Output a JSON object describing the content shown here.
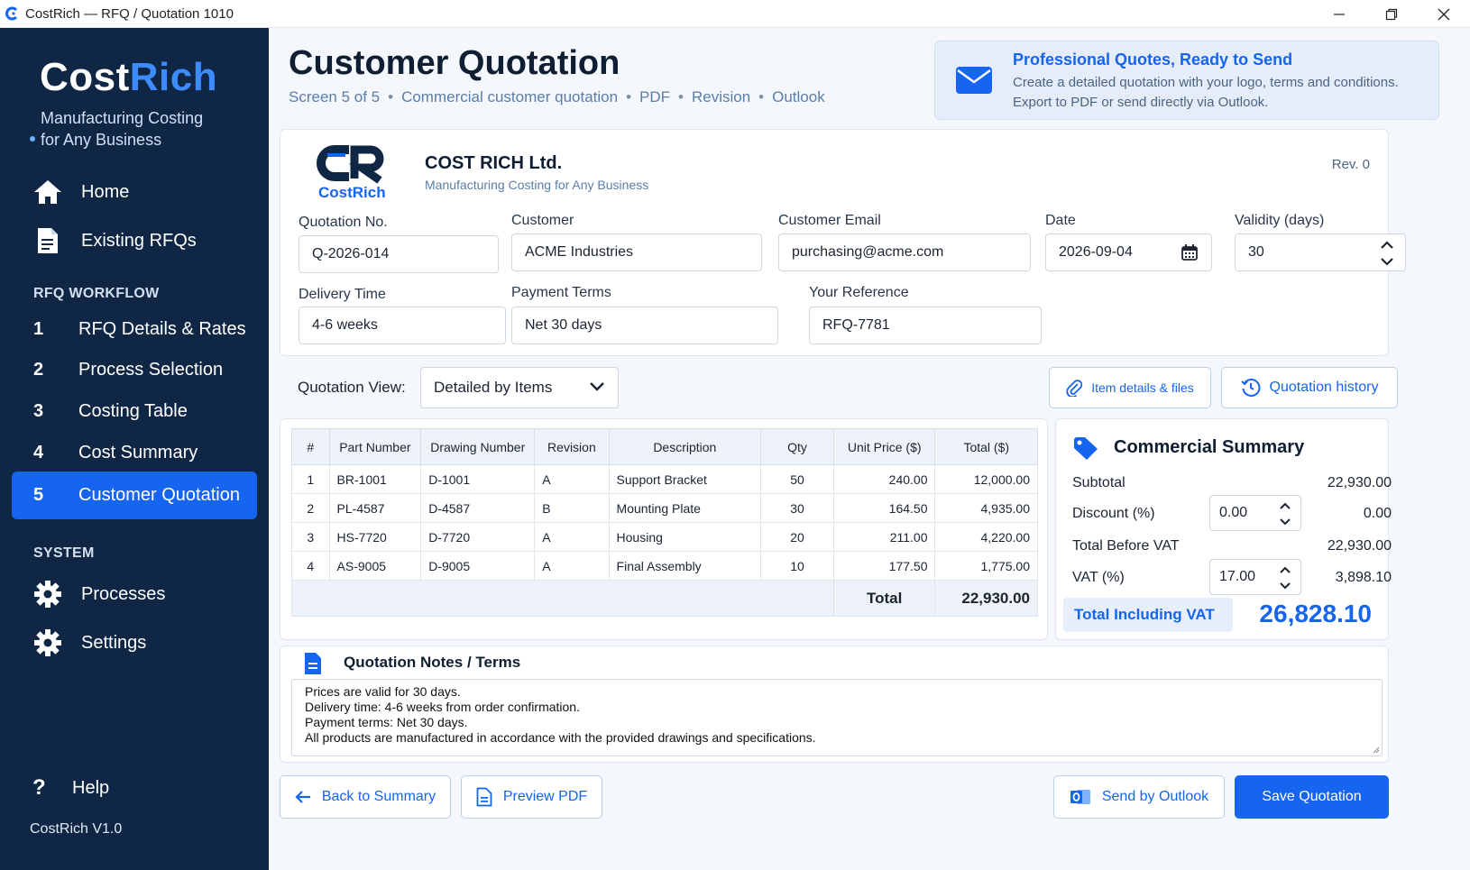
{
  "window": {
    "title": "CostRich — RFQ / Quotation 1010"
  },
  "sidebar": {
    "logo_a": "Cost",
    "logo_b": "Rich",
    "tagline_1": "Manufacturing Costing",
    "tagline_2": "for Any Business",
    "nav": [
      {
        "label": "Home",
        "icon": "home-icon"
      },
      {
        "label": "Existing RFQs",
        "icon": "document-icon"
      }
    ],
    "workflow_header": "RFQ WORKFLOW",
    "workflow": [
      {
        "num": "1",
        "label": "RFQ Details & Rates"
      },
      {
        "num": "2",
        "label": "Process Selection"
      },
      {
        "num": "3",
        "label": "Costing Table"
      },
      {
        "num": "4",
        "label": "Cost Summary"
      },
      {
        "num": "5",
        "label": "Customer Quotation"
      }
    ],
    "system_header": "SYSTEM",
    "system": [
      {
        "label": "Processes",
        "icon": "gear-icon"
      },
      {
        "label": "Settings",
        "icon": "gear-icon"
      }
    ],
    "help": "Help",
    "version": "CostRich  V1.0"
  },
  "header": {
    "title": "Customer Quotation",
    "crumbs": [
      "Screen 5 of 5",
      "Commercial customer quotation",
      "PDF",
      "Revision",
      "Outlook"
    ]
  },
  "promo": {
    "title": "Professional Quotes, Ready to Send",
    "line1": "Create a detailed quotation with your logo, terms and conditions.",
    "line2": "Export to PDF or send directly via Outlook."
  },
  "company": {
    "logo_text": "CostRich",
    "name": "COST RICH Ltd.",
    "subtitle": "Manufacturing Costing for Any Business",
    "revision": "Rev. 0"
  },
  "form": {
    "quotation_no_label": "Quotation No.",
    "quotation_no": "Q-2026-014",
    "customer_label": "Customer",
    "customer": "ACME Industries",
    "email_label": "Customer Email",
    "email": "purchasing@acme.com",
    "date_label": "Date",
    "date": "2026-09-04",
    "validity_label": "Validity (days)",
    "validity": "30",
    "delivery_label": "Delivery Time",
    "delivery": "4-6 weeks",
    "payment_label": "Payment Terms",
    "payment": "Net 30 days",
    "reference_label": "Your Reference",
    "reference": "RFQ-7781"
  },
  "view": {
    "label": "Quotation View:",
    "selected": "Detailed by Items",
    "item_details_btn": "Item details & files",
    "history_btn": "Quotation history"
  },
  "table": {
    "headers": [
      "#",
      "Part Number",
      "Drawing Number",
      "Revision",
      "Description",
      "Qty",
      "Unit Price ($)",
      "Total ($)"
    ],
    "rows": [
      [
        "1",
        "BR-1001",
        "D-1001",
        "A",
        "Support Bracket",
        "50",
        "240.00",
        "12,000.00"
      ],
      [
        "2",
        "PL-4587",
        "D-4587",
        "B",
        "Mounting Plate",
        "30",
        "164.50",
        "4,935.00"
      ],
      [
        "3",
        "HS-7720",
        "D-7720",
        "A",
        "Housing",
        "20",
        "211.00",
        "4,220.00"
      ],
      [
        "4",
        "AS-9005",
        "D-9005",
        "A",
        "Final Assembly",
        "10",
        "177.50",
        "1,775.00"
      ]
    ],
    "total_label": "Total",
    "total_value": "22,930.00"
  },
  "summary": {
    "title": "Commercial Summary",
    "subtotal_label": "Subtotal",
    "subtotal": "22,930.00",
    "discount_label": "Discount (%)",
    "discount_input": "0.00",
    "discount": "0.00",
    "before_vat_label": "Total Before VAT",
    "before_vat": "22,930.00",
    "vat_label": "VAT (%)",
    "vat_input": "17.00",
    "vat": "3,898.10",
    "grand_label": "Total Including VAT",
    "grand": "26,828.10"
  },
  "notes": {
    "title": "Quotation Notes / Terms",
    "lines": [
      "Prices are valid for 30 days.",
      "Delivery time: 4-6 weeks from order confirmation.",
      "Payment terms: Net 30 days.",
      "All products are manufactured in accordance with the provided drawings and specifications."
    ]
  },
  "actions": {
    "back": "Back to Summary",
    "preview": "Preview PDF",
    "outlook": "Send by Outlook",
    "save": "Save Quotation"
  },
  "colors": {
    "accent": "#1565f0",
    "sidebar": "#0f2745",
    "logo_blue": "#3d8bff"
  }
}
